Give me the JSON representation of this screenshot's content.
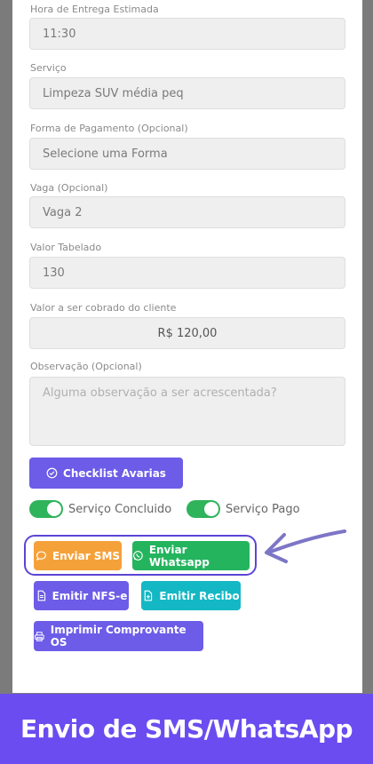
{
  "form": {
    "fields": [
      {
        "label": "Hora de Entrega Estimada",
        "value": "11:30"
      },
      {
        "label": "Serviço",
        "value": "Limpeza SUV média peq"
      },
      {
        "label": "Forma de Pagamento (Opcional)",
        "value": "Selecione uma Forma"
      },
      {
        "label": "Vaga (Opcional)",
        "value": "Vaga 2"
      },
      {
        "label": "Valor Tabelado",
        "value": "130"
      },
      {
        "label": "Valor a ser cobrado do cliente",
        "value": "R$ 120,00"
      }
    ],
    "observacao": {
      "label": "Observação (Opcional)",
      "placeholder": "Alguma observação a ser acrescentada?"
    }
  },
  "buttons": {
    "checklist": "Checklist Avarias",
    "sms": "Enviar SMS",
    "whatsapp": "Enviar Whatsapp",
    "nfse": "Emitir NFS-e",
    "recibo": "Emitir Recibo",
    "comprovante": "Imprimir Comprovante OS"
  },
  "toggles": {
    "concluido": "Serviço Concluido",
    "pago": "Serviço Pago"
  },
  "banner": "Envio de SMS/WhatsApp",
  "colors": {
    "accent": "#6c5ce7",
    "banner": "#6a4cf0",
    "whatsapp": "#24b45e",
    "sms": "#f5a13a",
    "recibo": "#14b8c4"
  }
}
